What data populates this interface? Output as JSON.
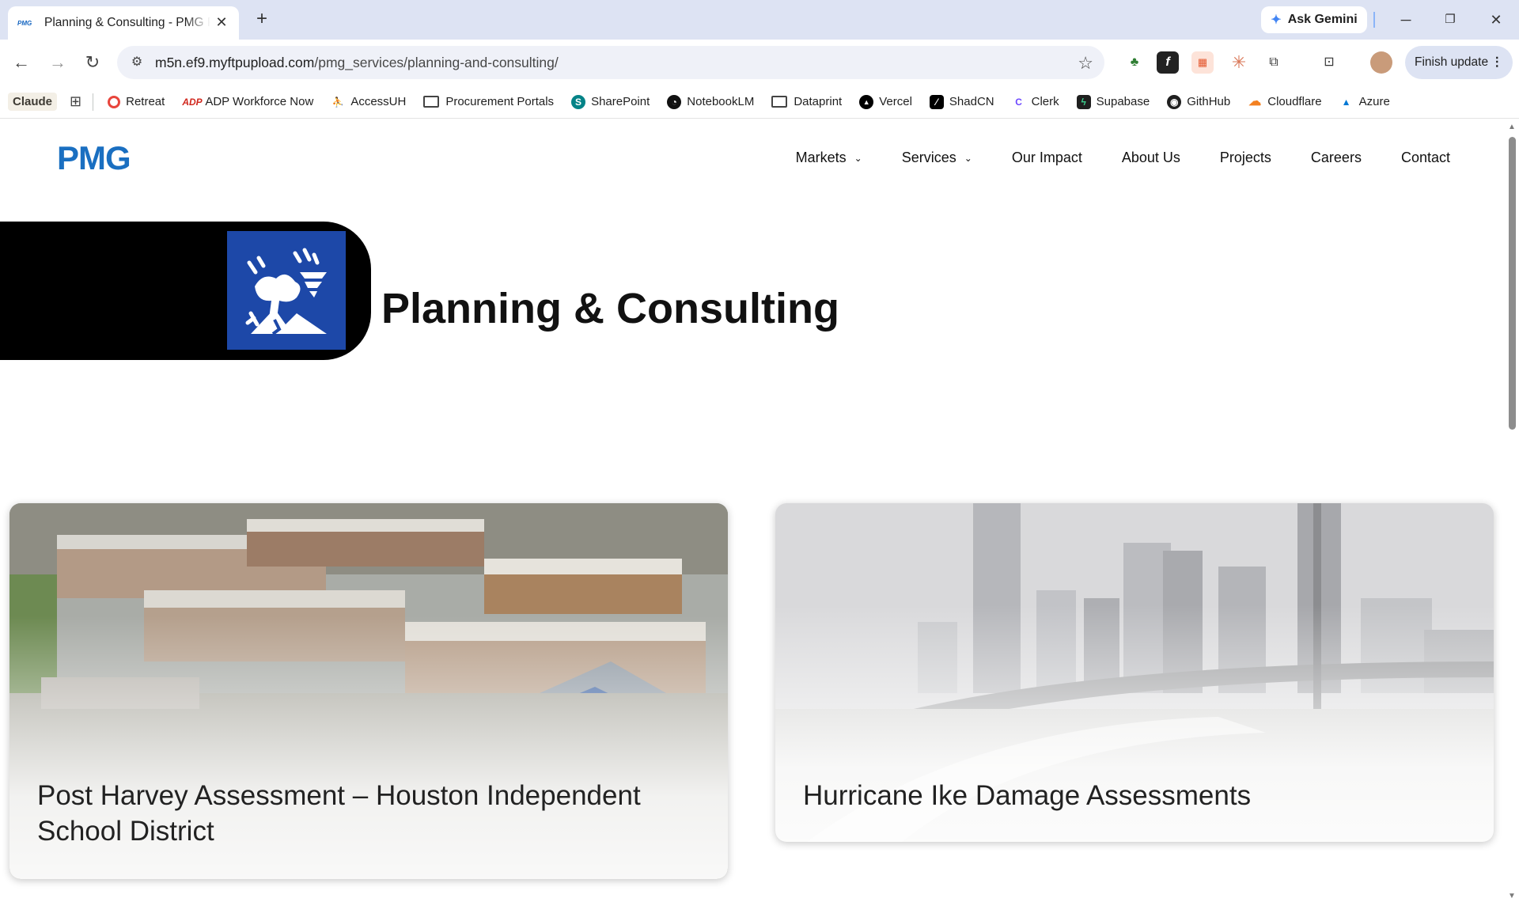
{
  "browser": {
    "tab": {
      "favicon_text": "PMG",
      "title": "Planning & Consulting - PMG P"
    },
    "ask_gemini": "Ask Gemini",
    "url_domain": "m5n.ef9.myftpupload.com",
    "url_path": "/pmg_services/planning-and-consulting/",
    "finish_update": "Finish update"
  },
  "bookmarks": [
    {
      "label": "Claude",
      "icon": "claude-icon"
    },
    {
      "label": "Retreat",
      "icon": "retreat-icon",
      "color": "#e8453c"
    },
    {
      "label": "ADP Workforce Now",
      "icon": "adp-icon",
      "color": "#d0271d"
    },
    {
      "label": "AccessUH",
      "icon": "accessuh-icon",
      "color": "#555555"
    },
    {
      "label": "Procurement Portals",
      "icon": "folder-icon"
    },
    {
      "label": "SharePoint",
      "icon": "sharepoint-icon",
      "color": "#038387"
    },
    {
      "label": "NotebookLM",
      "icon": "notebooklm-icon",
      "color": "#111111"
    },
    {
      "label": "Dataprint",
      "icon": "folder-icon"
    },
    {
      "label": "Vercel",
      "icon": "vercel-icon",
      "color": "#000000"
    },
    {
      "label": "ShadCN",
      "icon": "shadcn-icon",
      "color": "#000000"
    },
    {
      "label": "Clerk",
      "icon": "clerk-icon",
      "color": "#6c47ff"
    },
    {
      "label": "Supabase",
      "icon": "supabase-icon",
      "color": "#1f1f1f"
    },
    {
      "label": "GithHub",
      "icon": "github-icon",
      "color": "#1f1f1f"
    },
    {
      "label": "Cloudflare",
      "icon": "cloudflare-icon",
      "color": "#f38020"
    },
    {
      "label": "Azure",
      "icon": "azure-icon",
      "color": "#0078d4"
    }
  ],
  "site": {
    "logo": "PMG",
    "nav": [
      {
        "label": "Markets",
        "dropdown": true
      },
      {
        "label": "Services",
        "dropdown": true
      },
      {
        "label": "Our Impact",
        "dropdown": false
      },
      {
        "label": "About Us",
        "dropdown": false
      },
      {
        "label": "Projects",
        "dropdown": false
      },
      {
        "label": "Careers",
        "dropdown": false
      },
      {
        "label": "Contact",
        "dropdown": false
      }
    ],
    "hero_title": "Planning & Consulting",
    "brand_color": "#1a6fc1",
    "icon_bg_color": "#1d48a8"
  },
  "projects": [
    {
      "title": "Post Harvey Assessment – Houston Independent School District",
      "image": "flooded-school-photo"
    },
    {
      "title": "Hurricane Ike Damage Assessments",
      "image": "flooded-houston-skyline-photo"
    }
  ]
}
